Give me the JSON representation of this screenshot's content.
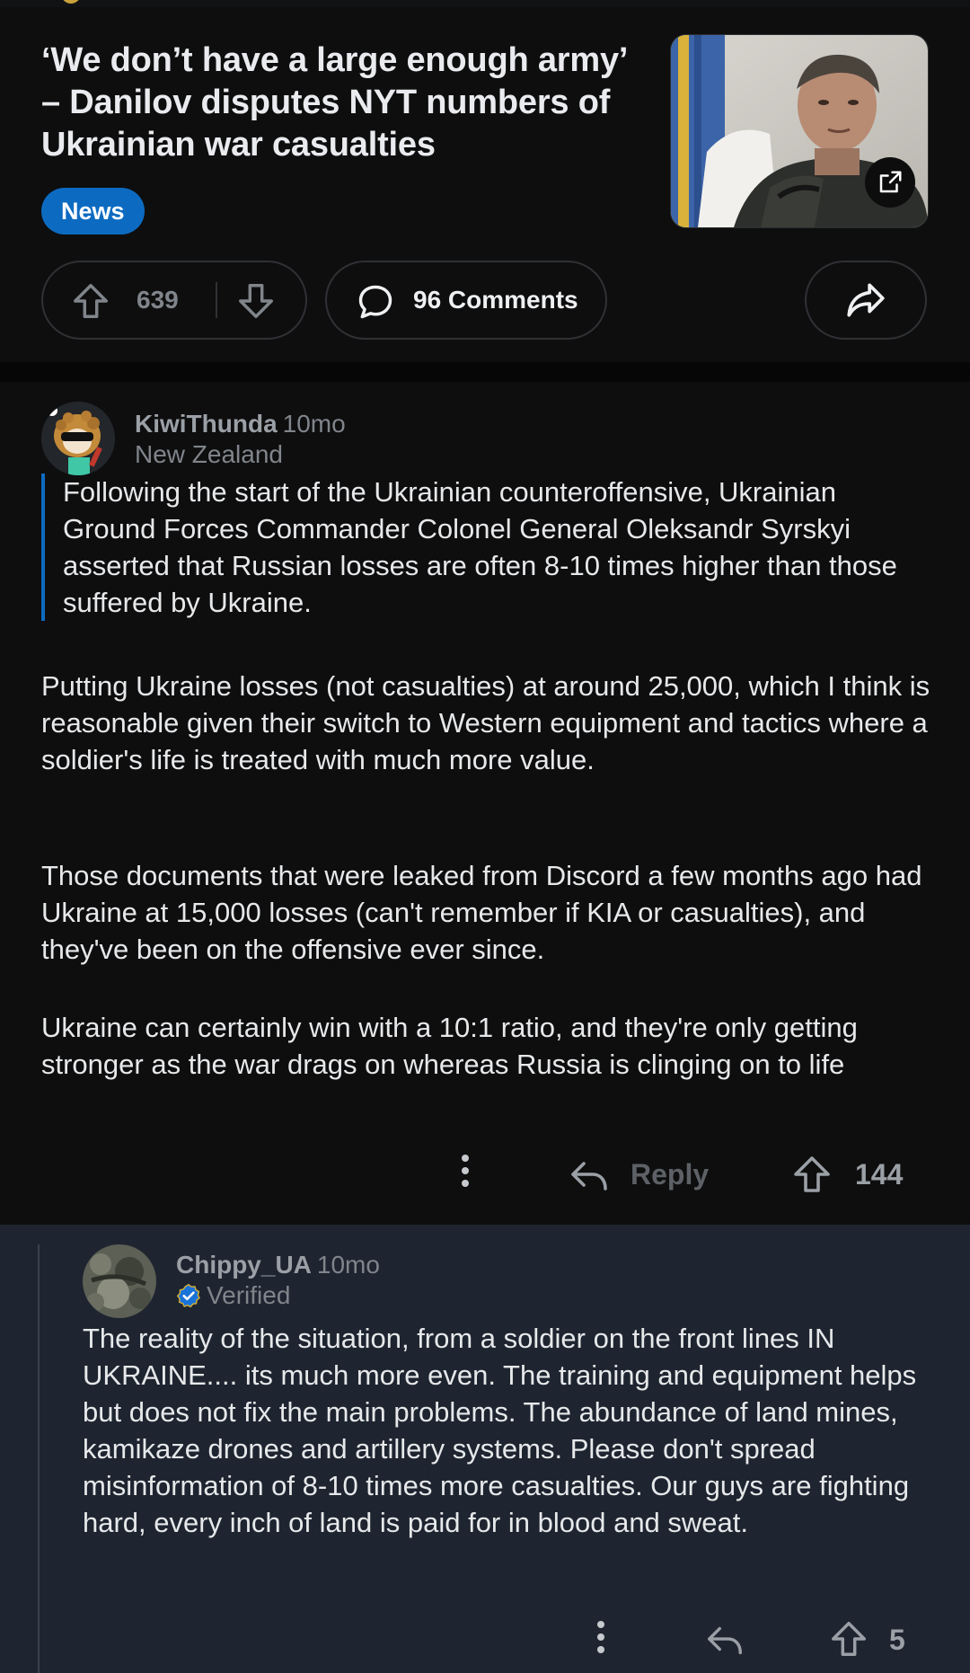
{
  "post": {
    "title": "‘We don’t have a large enough army’ – Danilov disputes NYT numbers of Ukrainian war casualties",
    "flair": "News",
    "vote_count": "639",
    "comments_label": "96 Comments"
  },
  "comments": [
    {
      "author": "KiwiThunda",
      "age": "10mo",
      "flair": "New Zealand",
      "quote": "Following the start of the Ukrainian counteroffensive, Ukrainian Ground Forces Commander Colonel General Oleksandr Syrskyi asserted that Russian losses are often 8-10 times higher than those suffered by Ukraine.",
      "paragraphs": [
        "Putting Ukraine losses (not casualties) at around 25,000, which I think is reasonable given their switch to Western equipment and tactics where a soldier's life is treated with much more value.",
        "Those documents that were leaked from Discord a few months ago had Ukraine at 15,000 losses (can't remember if KIA or casualties), and they've been on the offensive ever since.",
        "Ukraine can certainly win with a 10:1 ratio, and they're only getting stronger as the war drags on whereas Russia is clinging on to life"
      ],
      "reply_label": "Reply",
      "upvotes": "144"
    },
    {
      "author": "Chippy_UA",
      "age": "10mo",
      "flair": "Verified",
      "body": "The reality of the situation, from a soldier on the front lines IN UKRAINE.... its much more even. The training and equipment helps but does not fix the main problems. The abundance of land mines, kamikaze drones and artillery systems. Please don't spread misinformation of 8-10 times more casualties. Our guys are fighting hard, every inch of land is paid for in blood and sweat.",
      "upvotes": "5"
    }
  ],
  "colors": {
    "flair_blue": "#0c6bc1",
    "reply_background": "#1e2530",
    "verified_badge": "#1a73d9"
  },
  "icons": [
    "upvote-icon",
    "downvote-icon",
    "comment-bubble-icon",
    "share-icon",
    "external-link-icon",
    "overflow-menu-icon",
    "reply-icon",
    "verified-badge-icon"
  ]
}
